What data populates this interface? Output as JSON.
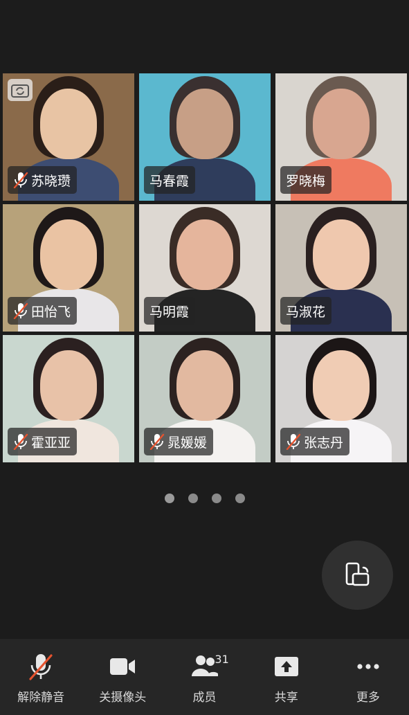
{
  "participants": [
    {
      "name": "苏晓瓒",
      "muted": true,
      "bg": "#8a6a4a",
      "skin": "#e8c4a4",
      "hair": "#2a1e18",
      "shirt": "#3d4d72"
    },
    {
      "name": "马春霞",
      "muted": false,
      "bg": "#5bb8cf",
      "skin": "#c79f86",
      "hair": "#3a3030",
      "shirt": "#2f3d5c"
    },
    {
      "name": "罗晓梅",
      "muted": false,
      "bg": "#d9d5cf",
      "skin": "#d8a690",
      "hair": "#6a5a50",
      "shirt": "#ef7a60"
    },
    {
      "name": "田怡飞",
      "muted": true,
      "bg": "#b7a27a",
      "skin": "#eac3a3",
      "hair": "#1e1818",
      "shirt": "#e8e6e8"
    },
    {
      "name": "马明霞",
      "muted": false,
      "bg": "#ddd8d2",
      "skin": "#e5b59c",
      "hair": "#3a2c26",
      "shirt": "#242424"
    },
    {
      "name": "马淑花",
      "muted": false,
      "bg": "#c7c0b6",
      "skin": "#efc8ae",
      "hair": "#2a2020",
      "shirt": "#2a3050"
    },
    {
      "name": "霍亚亚",
      "muted": true,
      "bg": "#c9d7cf",
      "skin": "#e8c2a8",
      "hair": "#2b2020",
      "shirt": "#f0e6de"
    },
    {
      "name": "晁媛媛",
      "muted": true,
      "bg": "#c3ccc5",
      "skin": "#e2b9a0",
      "hair": "#2c2220",
      "shirt": "#f4f2f0"
    },
    {
      "name": "张志丹",
      "muted": true,
      "bg": "#d5d3d2",
      "skin": "#f0ccb4",
      "hair": "#1c1616",
      "shirt": "#f6f4f6"
    }
  ],
  "pager": {
    "pages": 4,
    "current": 1
  },
  "toolbar": {
    "unmute": "解除静音",
    "camera_off": "关摄像头",
    "members": "成员",
    "members_count": "31",
    "share": "共享",
    "more": "更多"
  },
  "colors": {
    "muted_red": "#e5532f",
    "background": "#1c1c1c",
    "toolbar": "#262626"
  }
}
